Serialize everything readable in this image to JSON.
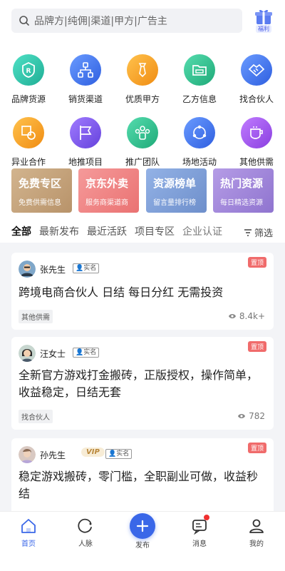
{
  "search": {
    "placeholder": "品牌方|纯佣|渠道|甲方|广告主"
  },
  "gift": {
    "label": "福利"
  },
  "grid_row1": [
    {
      "label": "品牌货源",
      "icon": "brand-shield-icon",
      "color": "#27c0a8"
    },
    {
      "label": "销货渠道",
      "icon": "network-icon",
      "color": "#3f74ef"
    },
    {
      "label": "优质甲方",
      "icon": "tie-icon",
      "color": "#f5a524"
    },
    {
      "label": "乙方信息",
      "icon": "folder-icon",
      "color": "#26c08f"
    },
    {
      "label": "找合伙人",
      "icon": "handshake-icon",
      "color": "#3f74ef"
    }
  ],
  "grid_row2": [
    {
      "label": "异业合作",
      "icon": "shapes-icon",
      "color": "#f5a524"
    },
    {
      "label": "地推项目",
      "icon": "flag-icon",
      "color": "#7d56e8"
    },
    {
      "label": "推广团队",
      "icon": "team-icon",
      "color": "#26c08f"
    },
    {
      "label": "场地活动",
      "icon": "share-icon",
      "color": "#3f74ef"
    },
    {
      "label": "其他供需",
      "icon": "cup-icon",
      "color": "#9a55e6"
    }
  ],
  "promos": [
    {
      "title": "免费专区",
      "sub": "免费供需信息",
      "color": "#c6a67e"
    },
    {
      "title": "京东外卖",
      "sub": "服务商渠道商",
      "color": "#f08787"
    },
    {
      "title": "资源榜单",
      "sub": "留言量排行榜",
      "color": "#7f9fd6"
    },
    {
      "title": "热门资源",
      "sub": "每日精选资源",
      "color": "#a288d8"
    }
  ],
  "tabs": [
    "全部",
    "最新发布",
    "最近活跃",
    "项目专区",
    "企业认证"
  ],
  "filter": {
    "label": "筛选"
  },
  "posts": [
    {
      "user": "张先生",
      "verified": "实名",
      "pinned": "置顶",
      "title": "跨境电商合伙人 日结 每日分红 无需投资",
      "category": "其他供需",
      "views": "8.4k+"
    },
    {
      "user": "汪女士",
      "verified": "实名",
      "pinned": "置顶",
      "title": "全新官方游戏打金搬砖，正版授权，操作简单，收益稳定，日结无套",
      "category": "找合伙人",
      "views": "782"
    },
    {
      "user": "孙先生",
      "vip": "VIP",
      "verified": "实名",
      "pinned": "置顶",
      "title": "稳定游戏搬砖，零门槛，全职副业可做，收益秒结"
    }
  ],
  "nav": [
    {
      "label": "首页",
      "icon": "home-icon"
    },
    {
      "label": "人脉",
      "icon": "contacts-icon"
    },
    {
      "label": "发布",
      "icon": "plus-icon"
    },
    {
      "label": "消息",
      "icon": "message-icon"
    },
    {
      "label": "我的",
      "icon": "profile-icon"
    }
  ],
  "colors": {
    "accent": "#3a67e8",
    "pin": "#f06b6b",
    "feed_bg": "#f3f4f7"
  }
}
